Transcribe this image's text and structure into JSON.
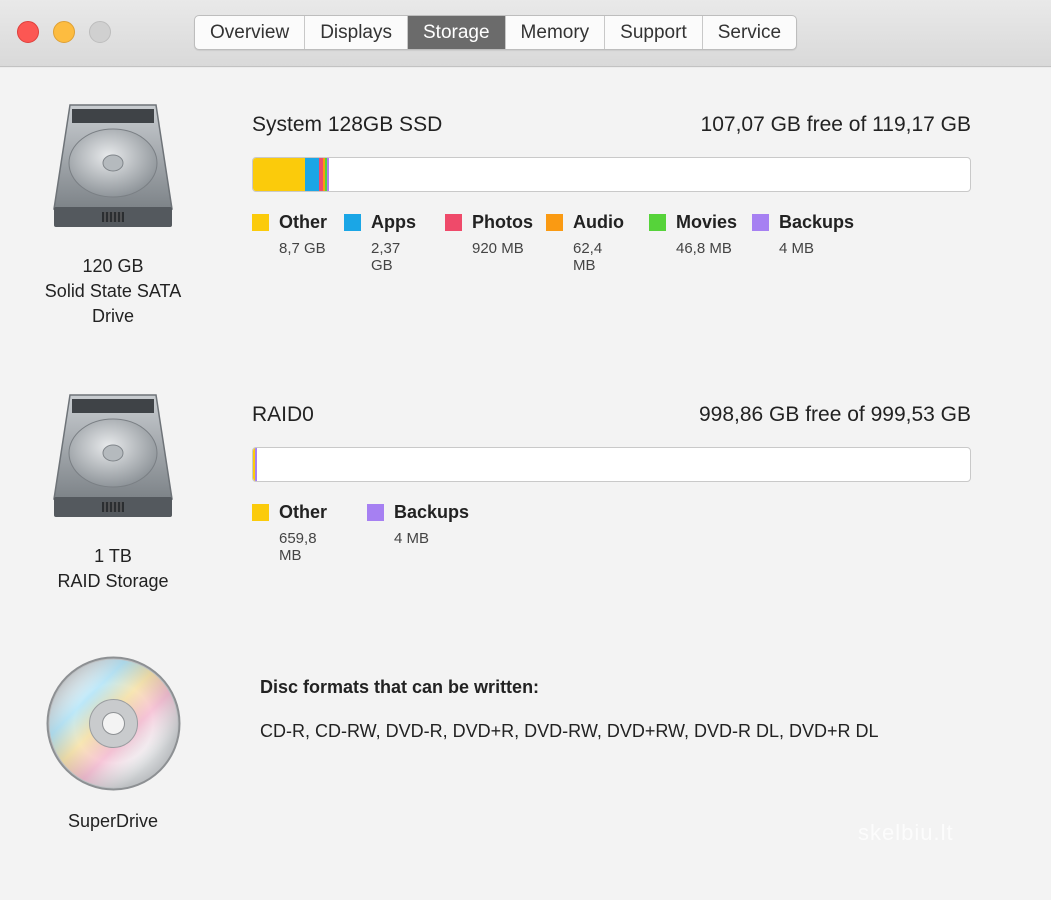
{
  "tabs": [
    {
      "label": "Overview",
      "active": false
    },
    {
      "label": "Displays",
      "active": false
    },
    {
      "label": "Storage",
      "active": true
    },
    {
      "label": "Memory",
      "active": false
    },
    {
      "label": "Support",
      "active": false
    },
    {
      "label": "Service",
      "active": false
    }
  ],
  "drives": [
    {
      "icon": "hard-drive-icon",
      "label_lines": [
        "120 GB",
        "Solid State SATA",
        "Drive"
      ],
      "volume_name": "System 128GB SSD",
      "free_text": "107,07 GB free of 119,17 GB",
      "categories": [
        {
          "name": "Other",
          "size": "8,7 GB",
          "color": "#fbcb0b",
          "fraction": 0.073
        },
        {
          "name": "Apps",
          "size": "2,37 GB",
          "color": "#1aa6e6",
          "fraction": 0.02
        },
        {
          "name": "Photos",
          "size": "920 MB",
          "color": "#ef4a6a",
          "fraction": 0.006
        },
        {
          "name": "Audio",
          "size": "62,4 MB",
          "color": "#fa9a12",
          "fraction": 0.0007
        },
        {
          "name": "Movies",
          "size": "46,8 MB",
          "color": "#56d33a",
          "fraction": 0.0005
        },
        {
          "name": "Backups",
          "size": "4 MB",
          "color": "#a680f2",
          "fraction": 0.0001
        }
      ]
    },
    {
      "icon": "hard-drive-icon",
      "label_lines": [
        "1 TB",
        "RAID Storage"
      ],
      "volume_name": "RAID0",
      "free_text": "998,86 GB free of 999,53 GB",
      "categories": [
        {
          "name": "Other",
          "size": "659,8 MB",
          "color": "#fbcb0b",
          "fraction": 0.0007
        },
        {
          "name": "Backups",
          "size": "4 MB",
          "color": "#a680f2",
          "fraction": 0.0001
        }
      ]
    }
  ],
  "optical": {
    "icon": "cd-disc-icon",
    "label": "SuperDrive",
    "formats_title": "Disc formats that can be written:",
    "formats": "CD-R, CD-RW, DVD-R, DVD+R, DVD-RW, DVD+RW, DVD-R DL, DVD+R DL"
  },
  "watermark": "skelbiu.lt"
}
